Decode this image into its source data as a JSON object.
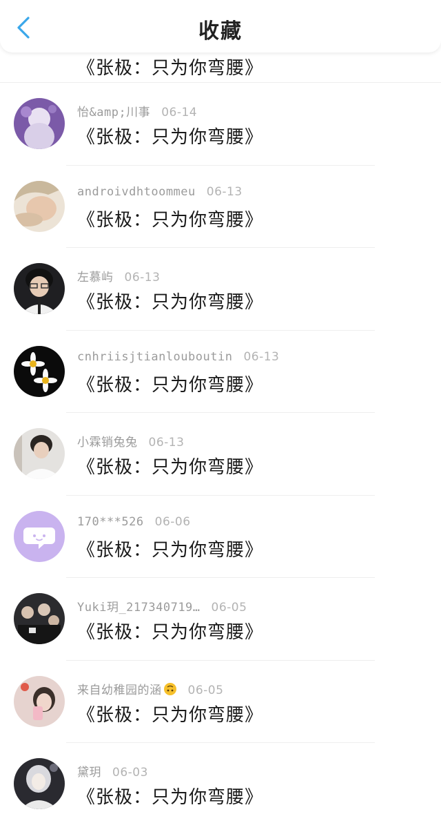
{
  "header": {
    "title": "收藏",
    "back_icon": "chevron-left-icon",
    "accent_color": "#3aa7ea"
  },
  "items": [
    {
      "user": "",
      "date": "",
      "content": "《张极：只为你弯腰》"
    },
    {
      "user": "怡&amp;川事",
      "date": "06-14",
      "content": "《张极：只为你弯腰》"
    },
    {
      "user": "androivdhtoommeu",
      "date": "06-13",
      "content": "《张极：只为你弯腰》"
    },
    {
      "user": "左慕屿",
      "date": "06-13",
      "content": "《张极：只为你弯腰》"
    },
    {
      "user": "cnhriisjtianlouboutin",
      "date": "06-13",
      "content": "《张极：只为你弯腰》"
    },
    {
      "user": "小霖销兔兔",
      "date": "06-13",
      "content": "《张极：只为你弯腰》"
    },
    {
      "user": "170***526",
      "date": "06-06",
      "content": "《张极：只为你弯腰》"
    },
    {
      "user": "Yuki玥_217340719…",
      "date": "06-05",
      "content": "《张极：只为你弯腰》"
    },
    {
      "user": "来自幼稚园的涵",
      "emoji": "upside-down-face-emoji",
      "date": "06-05",
      "content": "《张极：只为你弯腰》"
    },
    {
      "user": "黛玥",
      "date": "06-03",
      "content": "《张极：只为你弯腰》"
    }
  ]
}
